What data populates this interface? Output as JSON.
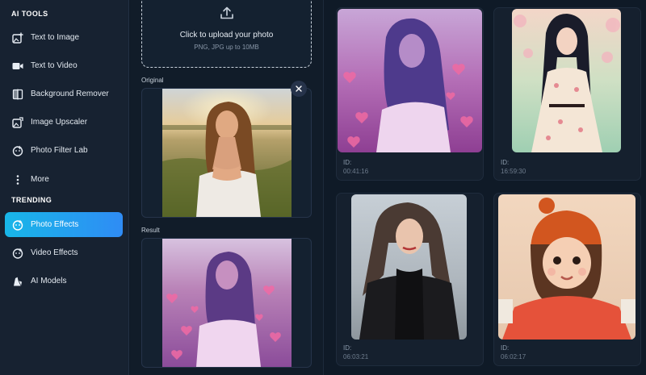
{
  "sidebar": {
    "sections": [
      {
        "title": "AI TOOLS",
        "items": [
          {
            "label": "Text to Image",
            "icon": "image-plus-icon"
          },
          {
            "label": "Text to Video",
            "icon": "video-camera-icon"
          },
          {
            "label": "Background Remover",
            "icon": "split-frame-icon"
          },
          {
            "label": "Image Upscaler",
            "icon": "image-upscale-icon"
          },
          {
            "label": "Photo Filter Lab",
            "icon": "filter-face-icon"
          },
          {
            "label": "More",
            "icon": "more-vertical-icon"
          }
        ]
      },
      {
        "title": "TRENDING",
        "items": [
          {
            "label": "Photo Effects",
            "icon": "photo-effects-icon",
            "active": true
          },
          {
            "label": "Video Effects",
            "icon": "video-effects-icon"
          },
          {
            "label": "AI Models",
            "icon": "ai-models-icon"
          }
        ]
      }
    ]
  },
  "upload": {
    "title": "Click to upload your photo",
    "subtitle": "PNG, JPG up to 10MB"
  },
  "original_label": "Original",
  "result_label": "Result",
  "gallery": [
    {
      "id_label": "ID:",
      "id_value": "00:41:16",
      "style": "purple-hearts"
    },
    {
      "id_label": "ID:",
      "id_value": "16:59:30",
      "style": "anime-dress"
    },
    {
      "id_label": "ID:",
      "id_value": "06:03:21",
      "style": "black-coat"
    },
    {
      "id_label": "ID:",
      "id_value": "06:02:17",
      "style": "3d-girl"
    }
  ],
  "colors": {
    "accent_start": "#18b6e8",
    "accent_end": "#2f8cf5",
    "sidebar_bg": "#172231",
    "page_bg": "#0f1926"
  }
}
